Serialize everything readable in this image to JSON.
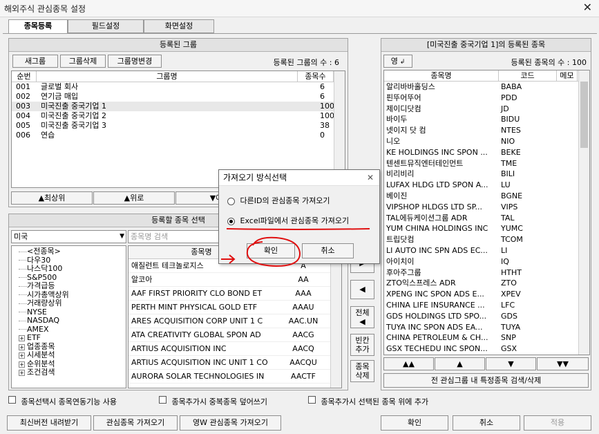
{
  "window": {
    "title": "해외주식 관심종목 설정",
    "close_glyph": "✕"
  },
  "tabs": [
    {
      "label": "종목등록"
    },
    {
      "label": "필드설정"
    },
    {
      "label": "화면설정"
    }
  ],
  "groups": {
    "header": "등록된 그룹",
    "buttons": {
      "new": "새그룹",
      "delete": "그룹삭제",
      "rename": "그룹명변경"
    },
    "count_label": "등록된 그룹의 수 : 6",
    "columns": {
      "no": "순번",
      "name": "그룹명",
      "count": "종목수"
    },
    "rows": [
      {
        "no": "001",
        "name": "글로벌 회사",
        "count": "6"
      },
      {
        "no": "002",
        "name": "연기금 매입",
        "count": "6"
      },
      {
        "no": "003",
        "name": "미국진출 중국기업 1",
        "count": "100"
      },
      {
        "no": "004",
        "name": "미국진출 중국기업 2",
        "count": "100"
      },
      {
        "no": "005",
        "name": "미국진출 중국기업 3",
        "count": "38"
      },
      {
        "no": "006",
        "name": "연습",
        "count": "0"
      }
    ],
    "move": {
      "top": "▲최상위",
      "up": "▲위로",
      "down": "▼아"
    }
  },
  "select": {
    "header": "등록할 종목 선택",
    "market": "미국",
    "search_placeholder": "종목명 검색",
    "tree": [
      {
        "label": "<전종목>",
        "expand": false
      },
      {
        "label": "다우30",
        "expand": false
      },
      {
        "label": "나스닥100",
        "expand": false
      },
      {
        "label": "S&P500",
        "expand": false
      },
      {
        "label": "가격급등",
        "expand": false
      },
      {
        "label": "시가총액상위",
        "expand": false
      },
      {
        "label": "거래량상위",
        "expand": false
      },
      {
        "label": "NYSE",
        "expand": false
      },
      {
        "label": "NASDAQ",
        "expand": false
      },
      {
        "label": "AMEX",
        "expand": false
      },
      {
        "label": "ETF",
        "expand": true
      },
      {
        "label": "업종종목",
        "expand": true
      },
      {
        "label": "시세분석",
        "expand": true
      },
      {
        "label": "순위분석",
        "expand": true
      },
      {
        "label": "조건검색",
        "expand": true
      }
    ],
    "columns": {
      "name": "종목명",
      "code": ""
    },
    "rows": [
      {
        "name": "애질런트 테크놀로지스",
        "code": "A"
      },
      {
        "name": "알코아",
        "code": "AA"
      },
      {
        "name": "AAF FIRST PRIORITY CLO BOND ET",
        "code": "AAA"
      },
      {
        "name": "PERTH MINT PHYSICAL GOLD ETF",
        "code": "AAAU"
      },
      {
        "name": "ARES ACQUISITION CORP UNIT 1 C",
        "code": "AAC.UN"
      },
      {
        "name": "ATA CREATIVITY GLOBAL SPON AD",
        "code": "AACG"
      },
      {
        "name": "ARTIUS ACQUISITION INC",
        "code": "AACQ"
      },
      {
        "name": "ARTIUS ACQUISITION INC UNIT 1 CO",
        "code": "AACQU"
      },
      {
        "name": "AURORA SOLAR TECHNOLOGIES IN",
        "code": "AACTF"
      }
    ]
  },
  "mid_buttons": {
    "add": "▶",
    "remove": "◀",
    "remove_all": "전체\n◀",
    "add_blank": "빈칸\n추가",
    "delete_item": "종목\n삭제"
  },
  "registered": {
    "header": "[미국진출 중국기업 1]의 등록된 종목",
    "sort_button": "영",
    "count_label": "등록된 종목의 수 : 100",
    "columns": {
      "name": "종목명",
      "code": "코드",
      "memo": "메모"
    },
    "rows": [
      {
        "name": "알리바바홀딩스",
        "code": "BABA"
      },
      {
        "name": "핀뚜어뚜어",
        "code": "PDD"
      },
      {
        "name": "제이디닷컴",
        "code": "JD"
      },
      {
        "name": "바이두",
        "code": "BIDU"
      },
      {
        "name": "넷이지 닷 컴",
        "code": "NTES"
      },
      {
        "name": "니오",
        "code": "NIO"
      },
      {
        "name": "KE HOLDINGS INC SPON ...",
        "code": "BEKE"
      },
      {
        "name": "텐센트뮤직엔터테인먼트",
        "code": "TME"
      },
      {
        "name": "비리비리",
        "code": "BILI"
      },
      {
        "name": "LUFAX HLDG LTD SPON A...",
        "code": "LU"
      },
      {
        "name": "베이진",
        "code": "BGNE"
      },
      {
        "name": "VIPSHOP HLDGS LTD SP...",
        "code": "VIPS"
      },
      {
        "name": "TAL에듀케이션그룹 ADR",
        "code": "TAL"
      },
      {
        "name": "YUM CHINA HOLDINGS INC",
        "code": "YUMC"
      },
      {
        "name": "트립닷컴",
        "code": "TCOM"
      },
      {
        "name": "LI AUTO INC SPN ADS EC...",
        "code": "LI"
      },
      {
        "name": "아이치이",
        "code": "IQ"
      },
      {
        "name": "후아주그룹",
        "code": "HTHT"
      },
      {
        "name": "ZTO익스프레스 ADR",
        "code": "ZTO"
      },
      {
        "name": "XPENG INC SPON ADS E...",
        "code": "XPEV"
      },
      {
        "name": "CHINA LIFE INSURANCE ...",
        "code": "LFC"
      },
      {
        "name": "GDS HOLDINGS LTD SPO...",
        "code": "GDS"
      },
      {
        "name": "TUYA INC SPON ADS EA...",
        "code": "TUYA"
      },
      {
        "name": "CHINA PETROLEUM & CH...",
        "code": "SNP"
      },
      {
        "name": "GSX TECHEDU INC SPON...",
        "code": "GSX"
      }
    ],
    "move": {
      "top": "▲▲",
      "up": "▲",
      "down": "▼",
      "bottom": "▼▼"
    },
    "search_all": "전 관심그룹 내 특정종목 검색/삭제"
  },
  "options": {
    "link": "종목선택시 종목연동기능 사용",
    "overwrite": "종목추가시 중복종목 덮어쓰기",
    "insert_above": "종목추가시 선택된 종목 위에 추가"
  },
  "footer": {
    "download": "최신버전 내려받기",
    "import": "관심종목 가져오기",
    "import_w": "영W 관심종목 가져오기",
    "ok": "확인",
    "cancel": "취소",
    "apply": "적용"
  },
  "dialog": {
    "title": "가져오기 방식선택",
    "close_glyph": "✕",
    "option1": "다른ID의 관심종목 가져오기",
    "option2": "Excel파일에서 관심종목 가져오기",
    "selected": 2,
    "ok": "확인",
    "cancel": "취소"
  },
  "annotation_color": "#e01010"
}
